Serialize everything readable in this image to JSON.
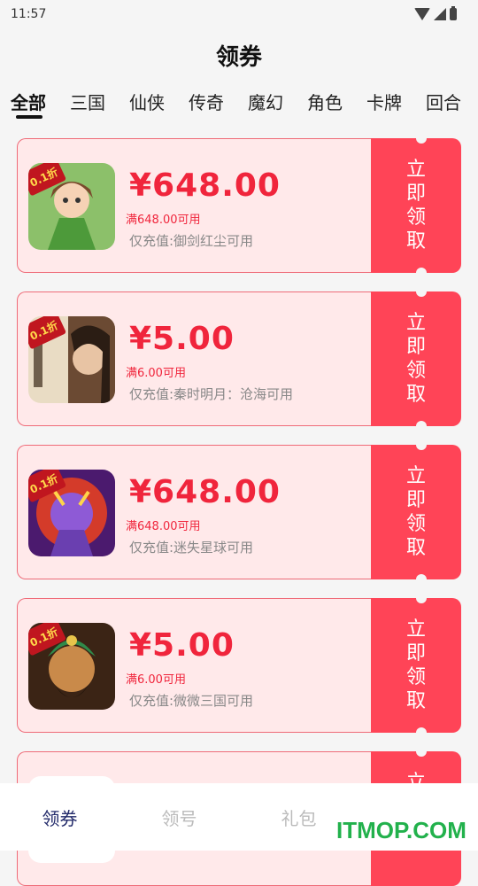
{
  "status_bar": {
    "time": "11:57"
  },
  "page": {
    "title": "领券"
  },
  "tabs": [
    {
      "label": "全部",
      "active": true
    },
    {
      "label": "三国"
    },
    {
      "label": "仙侠"
    },
    {
      "label": "传奇"
    },
    {
      "label": "魔幻"
    },
    {
      "label": "角色"
    },
    {
      "label": "卡牌"
    },
    {
      "label": "回合"
    }
  ],
  "coupons": [
    {
      "amount": "¥648.00",
      "condition": "满648.00可用",
      "scope": "仅充值:御剑红尘可用",
      "button": "立即领取",
      "badge": "0.1折"
    },
    {
      "amount": "¥5.00",
      "condition": "满6.00可用",
      "scope": "仅充值:秦时明月：沧海可用",
      "button": "立即领取",
      "badge": "0.1折"
    },
    {
      "amount": "¥648.00",
      "condition": "满648.00可用",
      "scope": "仅充值:迷失星球可用",
      "button": "立即领取",
      "badge": "0.1折"
    },
    {
      "amount": "¥5.00",
      "condition": "满6.00可用",
      "scope": "仅充值:微微三国可用",
      "button": "立即领取",
      "badge": "0.1折"
    },
    {
      "button": "立"
    }
  ],
  "bottom_nav": [
    {
      "label": "领券",
      "active": true
    },
    {
      "label": "领号"
    },
    {
      "label": "礼包"
    },
    {
      "label": ""
    }
  ],
  "watermark": "ITMOP.COM",
  "colors": {
    "accent_red": "#ff4457",
    "coupon_bg": "#ffe9ea",
    "nav_active": "#222a6a",
    "watermark": "#22b14c"
  }
}
